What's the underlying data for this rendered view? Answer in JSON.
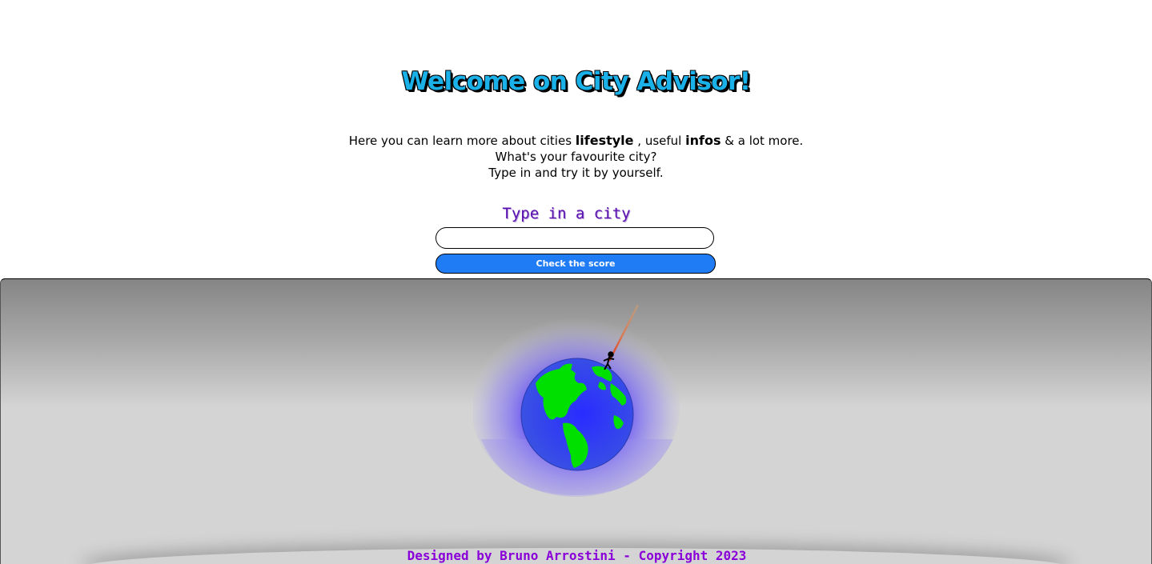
{
  "header": {
    "title": "Welcome on City Advisor!"
  },
  "intro": {
    "line1_prefix": "Here you can learn more about cities",
    "line1_bold1": "lifestyle",
    "line1_middle": ", useful",
    "line1_bold2": "infos",
    "line1_suffix": "& a lot more.",
    "line2": "What's your favourite city?",
    "line3": "Type in and try it by yourself."
  },
  "search": {
    "label": "Type in a city",
    "value": "",
    "placeholder": "",
    "button_label": "Check the score"
  },
  "illustration": {
    "name": "globe-with-astronaut",
    "ocean_color": "#2f3cf5",
    "land_color": "#00e000",
    "glow_color": "#6a55f5"
  },
  "footer": {
    "text": "Designed by Bruno Arrostini - Copyright 2023"
  }
}
